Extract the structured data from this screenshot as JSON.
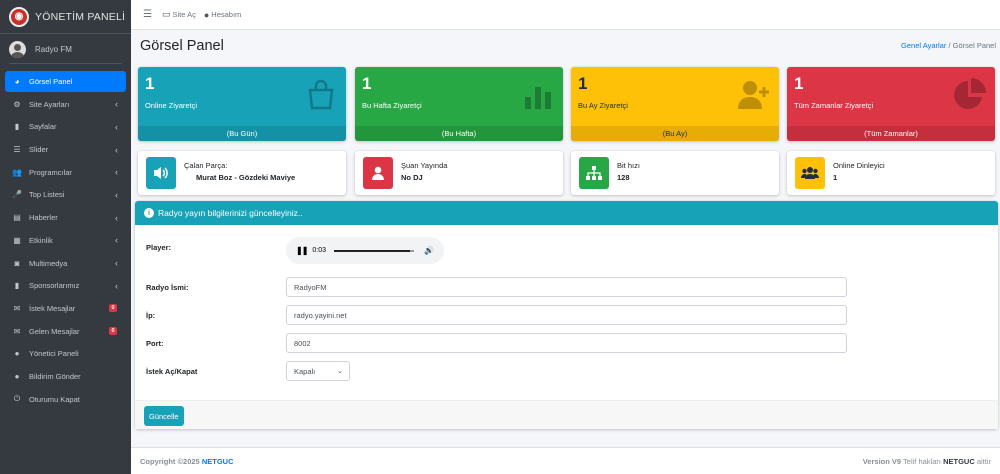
{
  "sidebar": {
    "brand": "YÖNETİM PANELİ",
    "username": "Radyo FM",
    "items": [
      {
        "label": "Görsel Panel",
        "icon": "dashboard-icon",
        "active": true
      },
      {
        "label": "Site Ayarları",
        "icon": "cogs-icon",
        "caret": true
      },
      {
        "label": "Sayfalar",
        "icon": "file-icon",
        "caret": true
      },
      {
        "label": "Slider",
        "icon": "sliders-icon",
        "caret": true
      },
      {
        "label": "Programcılar",
        "icon": "users-icon",
        "caret": true
      },
      {
        "label": "Top Listesi",
        "icon": "microphone-icon",
        "caret": true
      },
      {
        "label": "Haberler",
        "icon": "newspaper-icon",
        "caret": true
      },
      {
        "label": "Etkinlik",
        "icon": "calendar-icon",
        "caret": true
      },
      {
        "label": "Multimedya",
        "icon": "camera-icon",
        "caret": true
      },
      {
        "label": "Sponsorlarımız",
        "icon": "file-icon",
        "caret": true
      },
      {
        "label": "İstek Mesajlar",
        "icon": "envelope-icon",
        "badge": "0"
      },
      {
        "label": "Gelen Mesajlar",
        "icon": "envelope-icon",
        "badge": "0"
      },
      {
        "label": "Yönetici Paneli",
        "icon": "user-icon"
      },
      {
        "label": "Bildirim Gönder",
        "icon": "user-icon"
      },
      {
        "label": "Oturumu Kapat",
        "icon": "power-icon"
      }
    ]
  },
  "topbar": {
    "site_link": "Site Aç",
    "account_link": "Hesabım"
  },
  "header": {
    "title": "Görsel Panel",
    "breadcrumb_link": "Genel Ayarlar",
    "breadcrumb_sep": "/",
    "breadcrumb_current": "Görsel Panel"
  },
  "stats": [
    {
      "value": "1",
      "label": "Online Ziyaretçi",
      "footer": "(Bu Gün)",
      "color": "#17a2b8",
      "icon": "shopping-bag-icon"
    },
    {
      "value": "1",
      "label": "Bu Hafta Ziyaretçi",
      "footer": "(Bu Hafta)",
      "color": "#28a745",
      "icon": "bar-chart-icon"
    },
    {
      "value": "1",
      "label": "Bu Ay Ziyaretçi",
      "footer": "(Bu Ay)",
      "color": "#ffc107",
      "icon": "user-plus-icon"
    },
    {
      "value": "1",
      "label": "Tüm Zamanlar Ziyaretçi",
      "footer": "(Tüm Zamanlar)",
      "color": "#dc3545",
      "icon": "pie-chart-icon"
    }
  ],
  "infos": [
    {
      "label": "Çalan Parça:",
      "value": "Murat Boz - Gözdeki Maviye",
      "color": "#17a2b8",
      "icon": "volume-icon"
    },
    {
      "label": "Şuan Yayında",
      "value": "No DJ",
      "color": "#dc3545",
      "icon": "user-icon"
    },
    {
      "label": "Bit hızı",
      "value": "128",
      "color": "#28a745",
      "icon": "sitemap-icon"
    },
    {
      "label": "Online Dinleyici",
      "value": "1",
      "color": "#ffc107",
      "icon": "users-icon"
    }
  ],
  "form": {
    "header": "Radyo yayın bilgilerinizi güncelleyiniz..",
    "player_label": "Player:",
    "player_time": "0:03",
    "player_progress": 0.95,
    "name_label": "Radyo İsmi:",
    "name_value": "RadyoFM",
    "ip_label": "İp:",
    "ip_value": "radyo.yayini.net",
    "port_label": "Port:",
    "port_value": "8002",
    "request_label": "İstek Aç/Kapat",
    "request_value": "Kapalı",
    "submit": "Güncelle"
  },
  "footer": {
    "copyright": "Copyright ©2025",
    "brand": "NETGUC",
    "version": "Version V9",
    "rights": "Telif hakları",
    "rights_brand": "NETGUC",
    "rights_suffix": "aittir"
  }
}
